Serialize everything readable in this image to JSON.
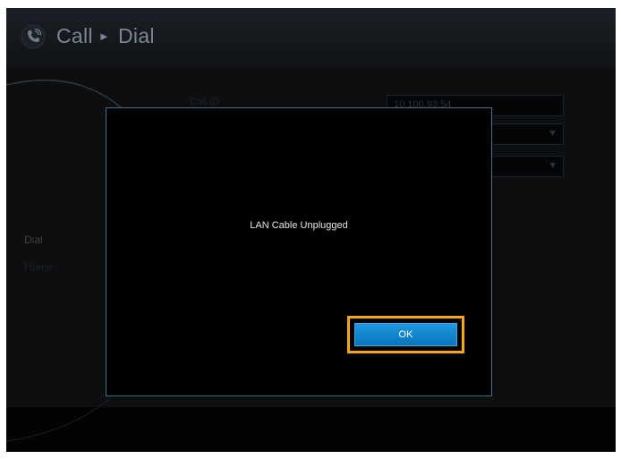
{
  "header": {
    "title": "Call",
    "breadcrumb_separator": "►",
    "page": "Dial",
    "icon": "phone-call-icon"
  },
  "sidebar": {
    "items": [
      {
        "label": "Dial"
      },
      {
        "label": "Home"
      }
    ]
  },
  "form": {
    "label_1": "Call ID",
    "field_1_value": "10.100.93.54"
  },
  "dialog": {
    "message": "LAN Cable Unplugged",
    "ok_label": "OK"
  },
  "colors": {
    "accent": "#1a8fd8",
    "focus": "#f5a41d",
    "dialog_border": "#3f6e8a"
  }
}
